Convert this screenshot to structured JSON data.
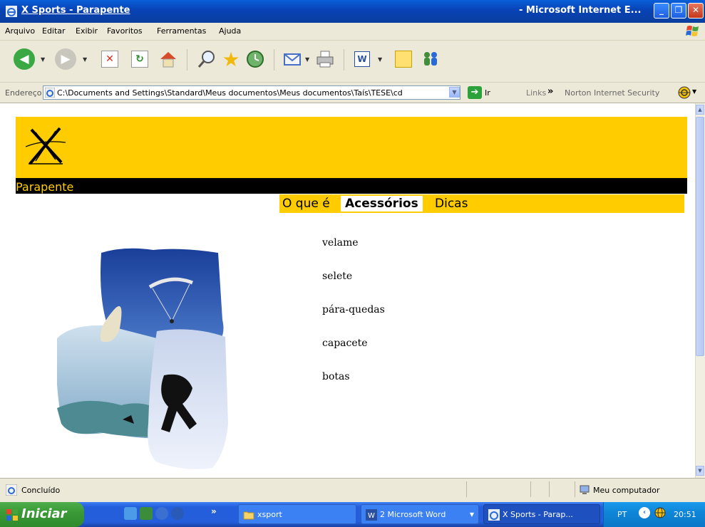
{
  "window": {
    "title_left": "X Sports - Parapente",
    "title_right": "- Microsoft Internet E..."
  },
  "menu": [
    "Arquivo",
    "Editar",
    "Exibir",
    "Favoritos",
    "Ferramentas",
    "Ajuda"
  ],
  "address": {
    "label": "Endereço",
    "value": "C:\\Documents and Settings\\Standard\\Meus documentos\\Meus documentos\\Taís\\TESE\\cd",
    "go_label": "Ir",
    "links_label": "Links",
    "norton_label": "Norton Internet Security"
  },
  "page": {
    "section_title": "Parapente",
    "tabs": [
      {
        "label": "O que é",
        "active": false
      },
      {
        "label": "Acessórios",
        "active": true
      },
      {
        "label": "Dicas",
        "active": false
      }
    ],
    "accessories": [
      "velame",
      "selete",
      "pára-quedas",
      "capacete",
      "botas"
    ],
    "colors": {
      "banner": "#ffcc00",
      "bar": "#000000"
    }
  },
  "status": {
    "text": "Concluído",
    "zone": "Meu computador"
  },
  "taskbar": {
    "start": "Iniciar",
    "tasks": [
      {
        "label": "xsport",
        "icon": "folder-icon"
      },
      {
        "label": "2 Microsoft Word",
        "icon": "word-icon"
      },
      {
        "label": "X Sports - Parap...",
        "icon": "ie-icon"
      }
    ],
    "language": "PT",
    "clock": "20:51"
  }
}
